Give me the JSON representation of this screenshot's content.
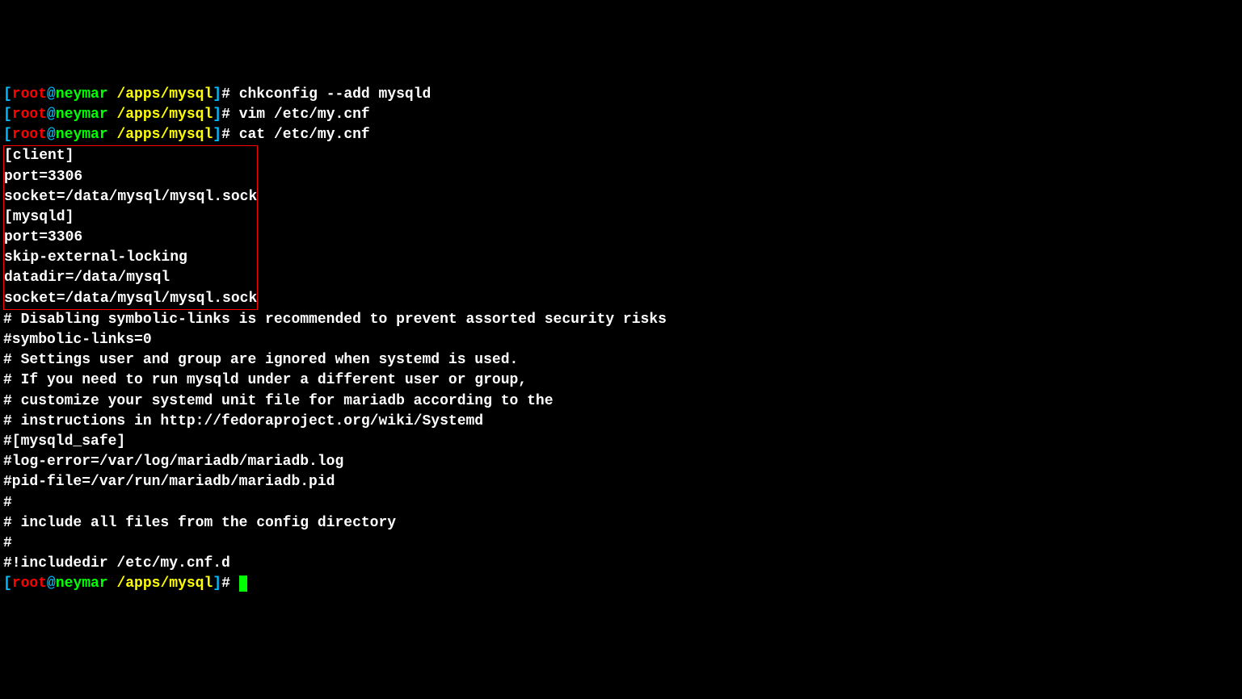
{
  "prompts": {
    "bracket_open": "[",
    "bracket_close": "]",
    "user": "root",
    "at": "@",
    "host": "neymar",
    "path": " /apps/mysql",
    "hash": "# "
  },
  "lines": {
    "cmd1": "chkconfig --add mysqld",
    "cmd2": "vim /etc/my.cnf",
    "cmd3": "cat /etc/my.cnf",
    "box": {
      "l1": "[client]",
      "l2": "port=3306",
      "l3": "socket=/data/mysql/mysql.sock",
      "l4": "",
      "l5": "[mysqld]",
      "l6": "port=3306",
      "l7": "skip-external-locking",
      "l8": "datadir=/data/mysql",
      "l9": "socket=/data/mysql/mysql.sock"
    },
    "out": {
      "l1": "# Disabling symbolic-links is recommended to prevent assorted security risks",
      "l2": "#symbolic-links=0",
      "l3": "# Settings user and group are ignored when systemd is used.",
      "l4": "# If you need to run mysqld under a different user or group,",
      "l5": "# customize your systemd unit file for mariadb according to the",
      "l6": "# instructions in http://fedoraproject.org/wiki/Systemd",
      "l7": "",
      "l8": "#[mysqld_safe]",
      "l9": "#log-error=/var/log/mariadb/mariadb.log",
      "l10": "#pid-file=/var/run/mariadb/mariadb.pid",
      "l11": "",
      "l12": "#",
      "l13": "# include all files from the config directory",
      "l14": "#",
      "l15": "#!includedir /etc/my.cnf.d",
      "l16": ""
    }
  }
}
